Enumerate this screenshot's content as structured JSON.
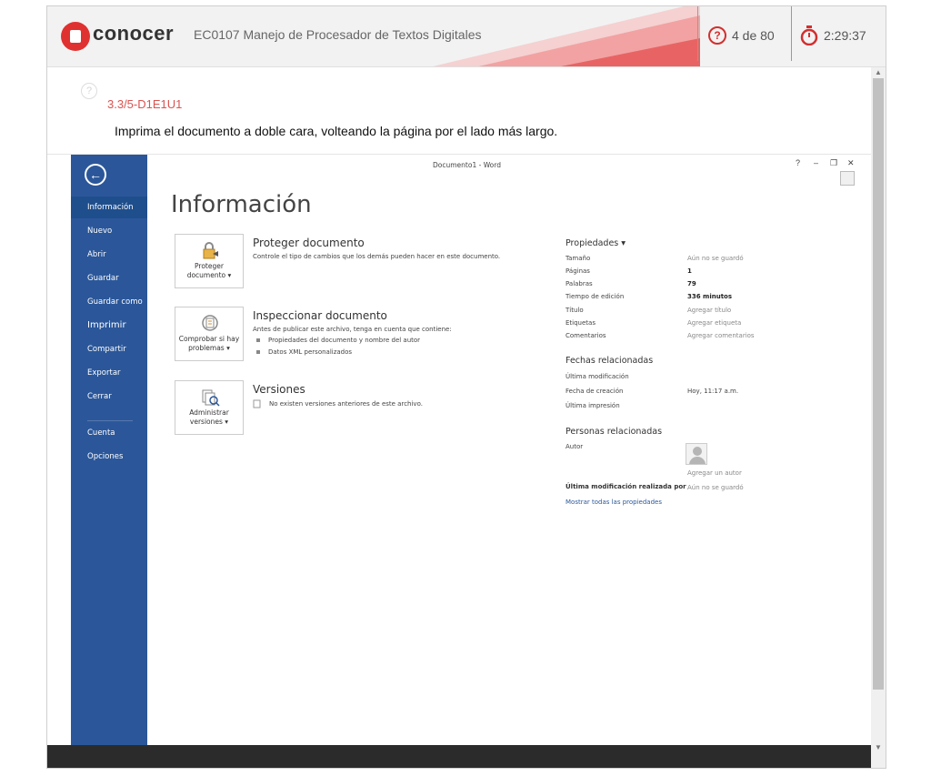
{
  "header": {
    "brand": "conocer",
    "course_title": "EC0107 Manejo de Procesador de Textos Digitales",
    "progress_label": "4 de 80",
    "timer": "2:29:37",
    "accent_color": "#e03131"
  },
  "question": {
    "code": "3.3/5-D1E1U1",
    "prompt": "Imprima el documento a doble cara, volteando la página por el lado más largo."
  },
  "word": {
    "window_title": "Documento1 - Word",
    "controls": [
      "?",
      "–",
      "❐",
      "✕"
    ],
    "nav": [
      {
        "label": "Información",
        "active": true
      },
      {
        "label": "Nuevo"
      },
      {
        "label": "Abrir"
      },
      {
        "label": "Guardar"
      },
      {
        "label": "Guardar como"
      },
      {
        "label": "Imprimir"
      },
      {
        "label": "Compartir"
      },
      {
        "label": "Exportar"
      },
      {
        "label": "Cerrar"
      },
      {
        "label": "Cuenta"
      },
      {
        "label": "Opciones"
      }
    ],
    "page_title": "Información",
    "sections": {
      "protect": {
        "tile": "Proteger documento ▾",
        "title": "Proteger documento",
        "desc": "Controle el tipo de cambios que los demás pueden hacer en este documento."
      },
      "inspect": {
        "tile": "Comprobar si hay problemas ▾",
        "title": "Inspeccionar documento",
        "desc": "Antes de publicar este archivo, tenga en cuenta que contiene:",
        "bullets": [
          "Propiedades del documento y nombre del autor",
          "Datos XML personalizados"
        ]
      },
      "versions": {
        "tile": "Administrar versiones ▾",
        "title": "Versiones",
        "desc": "No existen versiones anteriores de este archivo."
      }
    },
    "properties": {
      "heading": "Propiedades ▾",
      "rows": [
        {
          "label": "Tamaño",
          "value": "Aún no se guardó",
          "style": "muted"
        },
        {
          "label": "Páginas",
          "value": "1",
          "style": "bold"
        },
        {
          "label": "Palabras",
          "value": "79",
          "style": "bold"
        },
        {
          "label": "Tiempo de edición",
          "value": "336 minutos",
          "style": "bold"
        },
        {
          "label": "Título",
          "value": "Agregar título",
          "style": "muted"
        },
        {
          "label": "Etiquetas",
          "value": "Agregar etiqueta",
          "style": "muted"
        },
        {
          "label": "Comentarios",
          "value": "Agregar comentarios",
          "style": "muted"
        }
      ],
      "dates_heading": "Fechas relacionadas",
      "dates": [
        {
          "label": "Última modificación",
          "value": ""
        },
        {
          "label": "Fecha de creación",
          "value": "Hoy, 11:17 a.m."
        },
        {
          "label": "Última impresión",
          "value": ""
        }
      ],
      "people_heading": "Personas relacionadas",
      "author_label": "Autor",
      "add_author": "Agregar un autor",
      "last_modified_by_label": "Última modificación realizada por",
      "last_modified_by_value": "Aún no se guardó",
      "show_all_link": "Mostrar todas las propiedades"
    }
  }
}
